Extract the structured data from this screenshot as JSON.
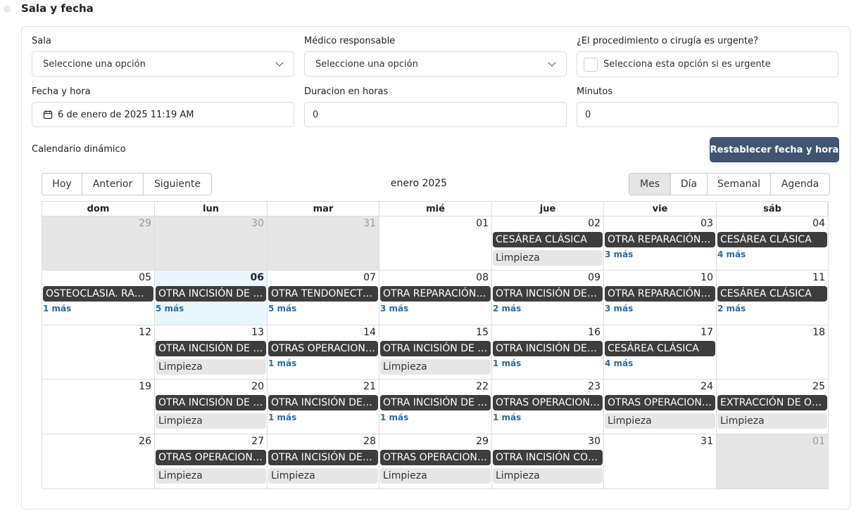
{
  "section": {
    "title": "Sala y fecha"
  },
  "form": {
    "sala_label": "Sala",
    "sala_value": "Seleccione una opción",
    "medico_label": "Médico responsable",
    "medico_value": "Seleccione una opción",
    "urgente_label": "¿El procedimiento o cirugía es urgente?",
    "urgente_text": "Selecciona esta opción si es urgente",
    "fecha_label": "Fecha y hora",
    "fecha_value": "6 de enero de 2025 11:19 AM",
    "duracion_label": "Duracion en horas",
    "duracion_value": "0",
    "minutos_label": "Minutos",
    "minutos_value": "0"
  },
  "calendar": {
    "label": "Calendario dinámico",
    "reset_button": "Restablecer fecha y hora",
    "nav": [
      "Hoy",
      "Anterior",
      "Siguiente"
    ],
    "month_label": "enero 2025",
    "views": [
      "Mes",
      "Día",
      "Semanal",
      "Agenda"
    ],
    "active_view": "Mes",
    "weekdays": [
      "dom",
      "lun",
      "mar",
      "mié",
      "jue",
      "vie",
      "sáb"
    ],
    "weeks": [
      [
        {
          "day": "29",
          "off": true
        },
        {
          "day": "30",
          "off": true
        },
        {
          "day": "31",
          "off": true
        },
        {
          "day": "01"
        },
        {
          "day": "02",
          "event": "CESÁREA CLÁSICA",
          "sub": "Limpieza"
        },
        {
          "day": "03",
          "event": "OTRA REPARACIÓN DE ÚTERO",
          "more": "3 más"
        },
        {
          "day": "04",
          "event": "CESÁREA CLÁSICA",
          "more": "4 más"
        }
      ],
      [
        {
          "day": "05",
          "event": "OSTEOCLASIA. RADIO Y CÚBITO",
          "more": "1 más"
        },
        {
          "day": "06",
          "today": true,
          "event": "OTRA INCISIÓN DE PIEL",
          "more": "5 más"
        },
        {
          "day": "07",
          "event": "OTRA TENDONECTOMÍA",
          "more": "5 más"
        },
        {
          "day": "08",
          "event": "OTRA REPARACIÓN DE ÚTERO",
          "more": "3 más"
        },
        {
          "day": "09",
          "event": "OTRA INCISIÓN DE PIEL",
          "more": "2 más"
        },
        {
          "day": "10",
          "event": "OTRA REPARACIÓN DE ÚTERO",
          "more": "3 más"
        },
        {
          "day": "11",
          "event": "CESÁREA CLÁSICA",
          "more": "2 más"
        }
      ],
      [
        {
          "day": "12"
        },
        {
          "day": "13",
          "event": "OTRA INCISIÓN DE PIEL",
          "sub": "Limpieza"
        },
        {
          "day": "14",
          "event": "OTRAS OPERACIONES DE PIEL",
          "more": "1 más"
        },
        {
          "day": "15",
          "event": "OTRA INCISIÓN DE PIEL",
          "sub": "Limpieza"
        },
        {
          "day": "16",
          "event": "OTRA INCISIÓN DE PIEL",
          "more": "1 más"
        },
        {
          "day": "17",
          "event": "CESÁREA CLÁSICA",
          "more": "4 más"
        },
        {
          "day": "18"
        }
      ],
      [
        {
          "day": "19"
        },
        {
          "day": "20",
          "event": "OTRA INCISIÓN DE PIEL",
          "sub": "Limpieza"
        },
        {
          "day": "21",
          "event": "OTRA INCISIÓN DE PIEL",
          "more": "1 más"
        },
        {
          "day": "22",
          "event": "OTRA INCISIÓN DE PIEL",
          "more": "1 más"
        },
        {
          "day": "23",
          "event": "OTRAS OPERACIONES DE PIEL",
          "more": "1 más"
        },
        {
          "day": "24",
          "event": "OTRAS OPERACIONES DE PIEL",
          "sub": "Limpieza"
        },
        {
          "day": "25",
          "event": "EXTRACCIÓN DE OTRO CUERPO",
          "sub": "Limpieza"
        }
      ],
      [
        {
          "day": "26"
        },
        {
          "day": "27",
          "event": "OTRAS OPERACIONES DE PIEL",
          "sub": "Limpieza"
        },
        {
          "day": "28",
          "event": "OTRA INCISIÓN DE PIEL",
          "sub": "Limpieza"
        },
        {
          "day": "29",
          "event": "OTRAS OPERACIONES DE PIEL",
          "sub": "Limpieza"
        },
        {
          "day": "30",
          "event": "OTRA INCISIÓN CON DRENAJE",
          "sub": "Limpieza"
        },
        {
          "day": "31"
        },
        {
          "day": "01",
          "off": true
        }
      ]
    ]
  }
}
